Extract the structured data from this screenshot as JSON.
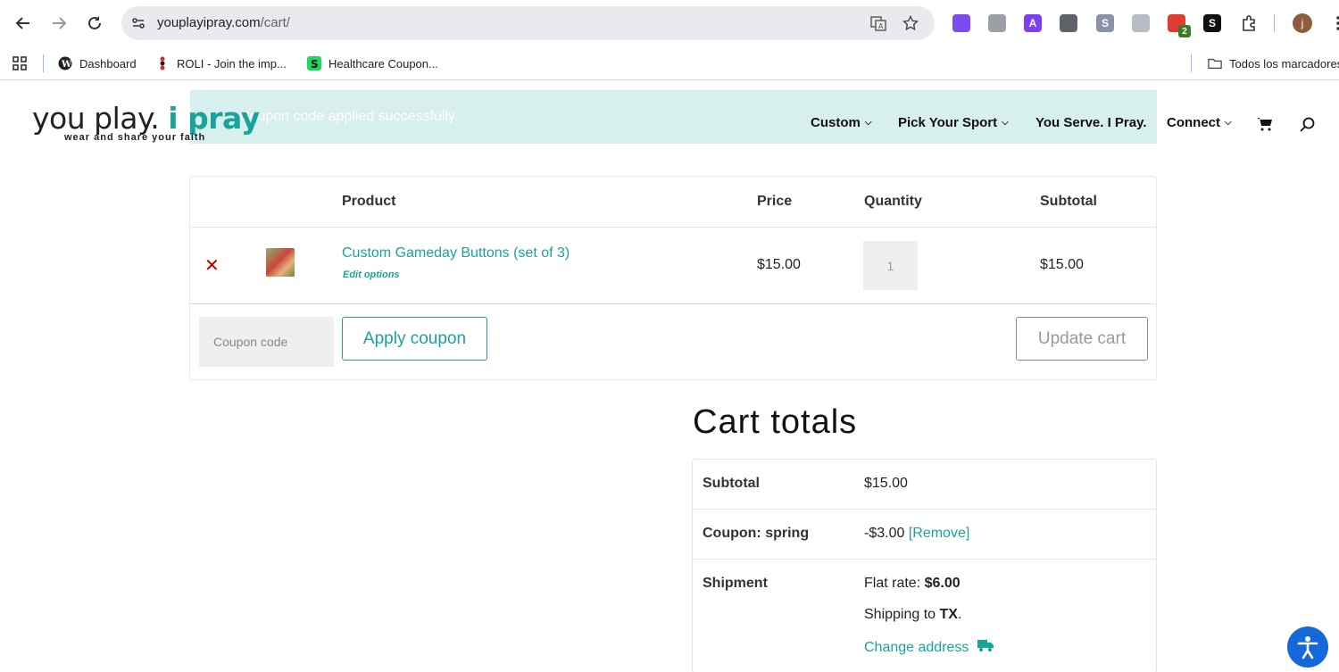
{
  "browser": {
    "url_host": "youplayipray.com",
    "url_path": "/cart/",
    "bookmarks": [
      {
        "label": "Dashboard"
      },
      {
        "label": "ROLI - Join the imp..."
      },
      {
        "label": "Healthcare Coupon..."
      }
    ],
    "all_bookmarks_label": "Todos los marcadores",
    "extensions": [
      {
        "name": "ext-purple-icon",
        "color": "#7b4cf0",
        "glyph": ""
      },
      {
        "name": "ext-gray-icon",
        "color": "#9aa0a6",
        "glyph": ""
      },
      {
        "name": "ext-a-icon",
        "color": "#7e3ff2",
        "glyph": "A"
      },
      {
        "name": "ext-brush-icon",
        "color": "#5f6368",
        "glyph": ""
      },
      {
        "name": "ext-s-icon",
        "color": "#8a93a6",
        "glyph": "S"
      },
      {
        "name": "ext-translate-icon",
        "color": "#b8bcc4",
        "glyph": ""
      },
      {
        "name": "ext-red-badge-icon",
        "color": "#e03b2f",
        "glyph": "",
        "badge": "2"
      },
      {
        "name": "ext-s-black-icon",
        "color": "#111111",
        "glyph": "S"
      }
    ],
    "profile_initial": "j"
  },
  "site": {
    "logo_text_1": "you play.",
    "logo_text_2": "i pray",
    "tagline": "wear and share your faith",
    "notice": "Coupon code applied successfully.",
    "nav": [
      {
        "label": "Custom",
        "dropdown": true
      },
      {
        "label": "Pick Your Sport",
        "dropdown": true
      },
      {
        "label": "You Serve. I Pray.",
        "dropdown": false
      },
      {
        "label": "Connect",
        "dropdown": true
      }
    ]
  },
  "cart": {
    "headers": {
      "product": "Product",
      "price": "Price",
      "quantity": "Quantity",
      "subtotal": "Subtotal"
    },
    "items": [
      {
        "name": "Custom Gameday Buttons (set of 3)",
        "edit_label": "Edit options",
        "price": "$15.00",
        "quantity": "1",
        "subtotal": "$15.00"
      }
    ],
    "coupon_placeholder": "Coupon code",
    "apply_label": "Apply coupon",
    "update_label": "Update cart"
  },
  "totals": {
    "title": "Cart totals",
    "subtotal_label": "Subtotal",
    "subtotal_value": "$15.00",
    "coupon_label": "Coupon: spring",
    "coupon_value": "-$3.00",
    "coupon_remove": "[Remove]",
    "shipment_label": "Shipment",
    "flat_rate_prefix": "Flat rate: ",
    "flat_rate_value": "$6.00",
    "shipping_to_prefix": "Shipping to ",
    "shipping_to_state": "TX",
    "shipping_to_suffix": ".",
    "change_address": "Change address"
  },
  "colors": {
    "accent": "#1aa39a",
    "remove": "#bb0000",
    "accessibility": "#1469d8"
  }
}
